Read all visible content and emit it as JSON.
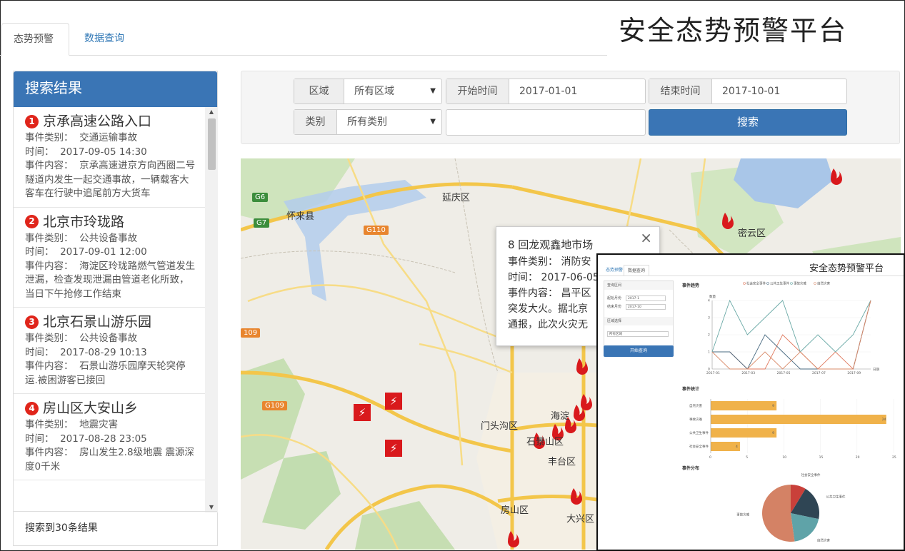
{
  "app": {
    "title": "安全态势预警平台"
  },
  "tabs": [
    {
      "label": "态势预警",
      "active": true
    },
    {
      "label": "数据查询",
      "active": false
    }
  ],
  "sidebar": {
    "header": "搜索结果",
    "results": [
      {
        "num": "1",
        "title": "京承高速公路入口",
        "category_label": "事件类别：",
        "category": "交通运输事故",
        "time_label": "时间：",
        "time": "2017-09-05 14:30",
        "content_label": "事件内容：",
        "content": "京承高速进京方向西圈二号隧道内发生一起交通事故，一辆载客大客车在行驶中追尾前方大货车"
      },
      {
        "num": "2",
        "title": "北京市玲珑路",
        "category_label": "事件类别：",
        "category": "公共设备事故",
        "time_label": "时间：",
        "time": "2017-09-01 12:00",
        "content_label": "事件内容：",
        "content": "海淀区玲珑路燃气管道发生泄漏，检查发现泄漏由管道老化所致，当日下午抢修工作结束"
      },
      {
        "num": "3",
        "title": "北京石景山游乐园",
        "category_label": "事件类别：",
        "category": "公共设备事故",
        "time_label": "时间：",
        "time": "2017-08-29 10:13",
        "content_label": "事件内容：",
        "content": "石景山游乐园摩天轮突停运.被困游客已接回"
      },
      {
        "num": "4",
        "title": "房山区大安山乡",
        "category_label": "事件类别：",
        "category": "地震灾害",
        "time_label": "时间：",
        "time": "2017-08-28 23:05",
        "content_label": "事件内容：",
        "content": "房山发生2.8级地震 震源深度0千米"
      }
    ],
    "count_text": "搜索到30条结果"
  },
  "filters": {
    "region_label": "区域",
    "region_value": "所有区域",
    "start_label": "开始时间",
    "start_value": "2017-01-01",
    "end_label": "结束时间",
    "end_value": "2017-10-01",
    "category_label": "类别",
    "category_value": "所有类别",
    "search_input_value": "",
    "search_button": "搜索"
  },
  "map": {
    "labels": [
      "延庆区",
      "怀来县",
      "密云区",
      "门头沟区",
      "石景山区",
      "丰台区",
      "房山区",
      "大兴区",
      "海淀"
    ],
    "shields": [
      "G6",
      "G7",
      "G110",
      "G109",
      "109"
    ],
    "popup": {
      "title": "8 回龙观鑫地市场",
      "category_line": "事件类别：  消防安",
      "time_line": "时间：  2017-06-05",
      "content_line1": "事件内容：  昌平区",
      "content_line2": "突发大火。据北京",
      "content_line3": "通报，此次火灾无",
      "close": "×"
    },
    "icons": {
      "fire": "fire-icon",
      "power": "lightning-icon"
    },
    "colors": {
      "fire": "#d9191c",
      "road": "#f7d35a",
      "water": "#a9c6e8",
      "green": "#bfdcaa"
    }
  },
  "inset": {
    "title": "安全态势预警平台",
    "tabs": [
      "态势预警",
      "数据查询"
    ],
    "query_section": "查询区间",
    "start_label": "起始月份",
    "start_value": "2017-1",
    "end_label": "结束月份",
    "end_value": "2017-10",
    "region_section": "区域选择",
    "region_value": "所有区域",
    "button": "开始查询",
    "trend_title": "事件趋势",
    "stats_title": "事件统计",
    "dist_title": "事件分布",
    "trend_legend": [
      "社会安全事件",
      "公共卫生事件",
      "事故灾难",
      "自然灾害"
    ],
    "trend_ylabel": "数量",
    "trend_xlabel": "日期",
    "trend_xticks": [
      "2017-01",
      "2017-03",
      "2017-05",
      "2017-07",
      "2017-09"
    ],
    "trend_yticks": [
      "0",
      "1",
      "2",
      "3",
      "4"
    ],
    "bar_categories": [
      "自然灾害",
      "事故灾难",
      "公共卫生事件",
      "社会安全事件"
    ],
    "bar_values": [
      9,
      24,
      9,
      4
    ],
    "bar_xticks": [
      "0",
      "5",
      "10",
      "15",
      "20",
      "25"
    ],
    "pie_labels": [
      "社会安全事件",
      "公共卫生事件",
      "自然灾害",
      "事故灾难"
    ]
  },
  "chart_data": [
    {
      "type": "line",
      "title": "事件趋势",
      "xlabel": "日期",
      "ylabel": "数量",
      "x": [
        "2017-01",
        "2017-02",
        "2017-03",
        "2017-04",
        "2017-05",
        "2017-06",
        "2017-07",
        "2017-08",
        "2017-09",
        "2017-10"
      ],
      "series": [
        {
          "name": "社会安全事件",
          "values": [
            1,
            1,
            0,
            0,
            2,
            1,
            0,
            1,
            0,
            4
          ]
        },
        {
          "name": "公共卫生事件",
          "values": [
            1,
            1,
            0,
            2,
            1,
            0,
            0,
            0,
            0,
            4
          ]
        },
        {
          "name": "事故灾难",
          "values": [
            1,
            4,
            2,
            3,
            4,
            1,
            2,
            1,
            2,
            4
          ]
        },
        {
          "name": "自然灾害",
          "values": [
            1,
            0,
            0,
            1,
            0,
            1,
            0,
            0,
            0,
            4
          ]
        }
      ],
      "ylim": [
        0,
        4
      ],
      "legend": "top"
    },
    {
      "type": "bar",
      "title": "事件统计",
      "categories": [
        "自然灾害",
        "事故灾难",
        "公共卫生事件",
        "社会安全事件"
      ],
      "values": [
        9,
        24,
        9,
        4
      ],
      "xlim": [
        0,
        25
      ],
      "orientation": "horizontal"
    },
    {
      "type": "pie",
      "title": "事件分布",
      "categories": [
        "社会安全事件",
        "公共卫生事件",
        "自然灾害",
        "事故灾难"
      ],
      "values": [
        4,
        9,
        9,
        24
      ]
    }
  ]
}
